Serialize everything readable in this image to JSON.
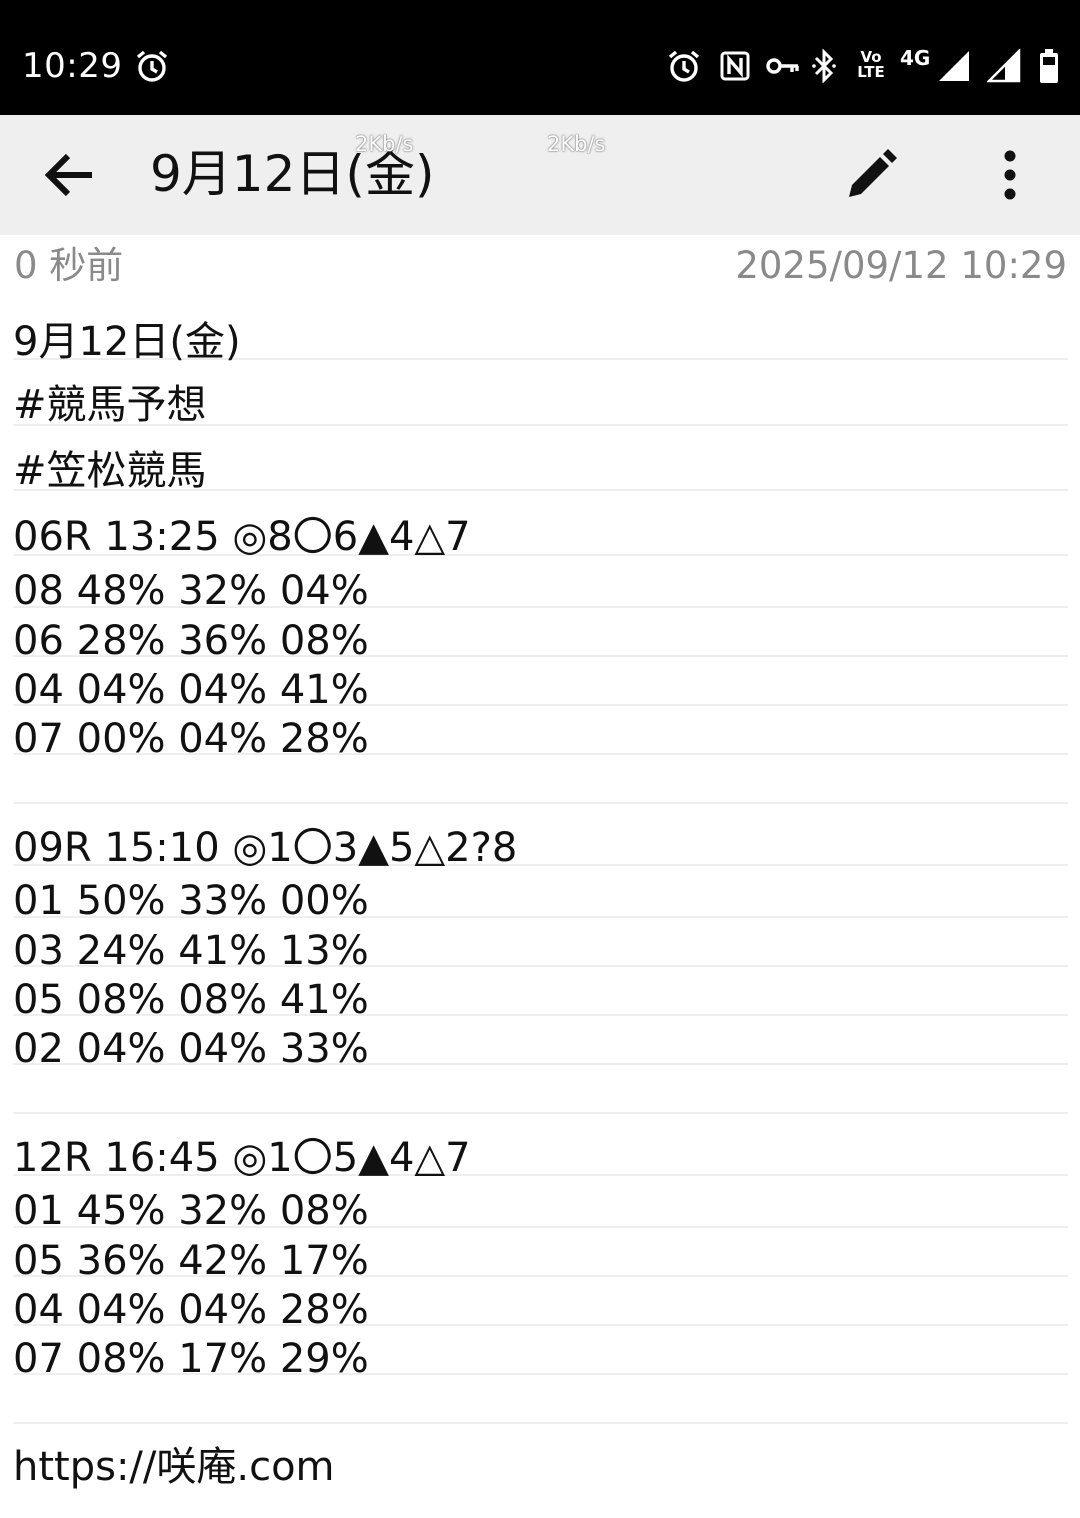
{
  "status_bar": {
    "time": "10:29",
    "icons": [
      "alarm-icon",
      "alarm-icon",
      "nfc-icon",
      "vpn-key-icon",
      "bluetooth-icon",
      "volte-icon",
      "signal-icon",
      "signal-icon",
      "battery-icon"
    ],
    "volte_top": "Vo",
    "volte_bottom": "LTE",
    "network": "4G"
  },
  "app_bar": {
    "title": "9月12日(金)",
    "speed_overlay_1": "2Kb/s",
    "speed_overlay_2": "2Kb/s",
    "back_icon": "arrow-back-icon",
    "edit_icon": "pencil-icon",
    "more_icon": "more-vert-icon"
  },
  "meta": {
    "relative_time": "0 秒前",
    "timestamp": "2025/09/12 10:29"
  },
  "note": {
    "lines": [
      "9月12日(金)",
      "#競馬予想",
      "#笠松競馬",
      "06R 13:25 ◎8〇6▲4△7",
      "08 48% 32% 04%",
      "06 28% 36% 08%",
      "04 04% 04% 41%",
      "07 00% 04% 28%",
      "",
      "09R 15:10 ◎1〇3▲5△2?8",
      "01 50% 33% 00%",
      "03 24% 41% 13%",
      "05 08% 08% 41%",
      "02 04% 04% 33%",
      "",
      "12R 16:45 ◎1〇5▲4△7",
      "01 45% 32% 08%",
      "05 36% 42% 17%",
      "04 04% 04% 28%",
      "07 08% 17% 29%",
      "",
      "https://咲庵.com"
    ]
  },
  "colors": {
    "status_bar_bg": "#000000",
    "app_bar_bg": "#efefef",
    "meta_text": "#8a8a8a",
    "rule_line": "#eeeeee"
  }
}
